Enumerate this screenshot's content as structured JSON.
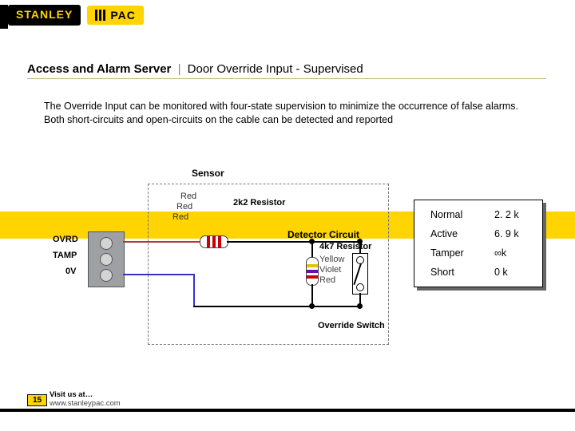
{
  "brand": {
    "stanley": "STANLEY",
    "pac": "PAC"
  },
  "title": {
    "main": "Access and Alarm Server",
    "sub": "Door Override Input - Supervised"
  },
  "body": "The Override Input can be monitored with four-state supervision to minimize the occurrence of false alarms. Both short-circuits and open-circuits on the cable can be detected and reported",
  "states": [
    {
      "name": "Normal",
      "value": "2. 2 k"
    },
    {
      "name": "Active",
      "value": "6. 9 k"
    },
    {
      "name": "Tamper",
      "value": "∞k"
    },
    {
      "name": "Short",
      "value": "0 k"
    }
  ],
  "diagram": {
    "title": "Sensor",
    "terminals": [
      "OVRD",
      "TAMP",
      "0V"
    ],
    "r1": {
      "label": "2k2 Resistor",
      "bands": [
        "Red",
        "Red",
        "Red"
      ]
    },
    "r2": {
      "label": "4k7 Resistor",
      "bands": [
        "Yellow",
        "Violet",
        "Red"
      ]
    },
    "detector": "Detector Circuit",
    "switch": "Override Switch"
  },
  "footer": {
    "page": "15",
    "visit": "Visit us at…",
    "url": "www.stanleypac.com"
  }
}
